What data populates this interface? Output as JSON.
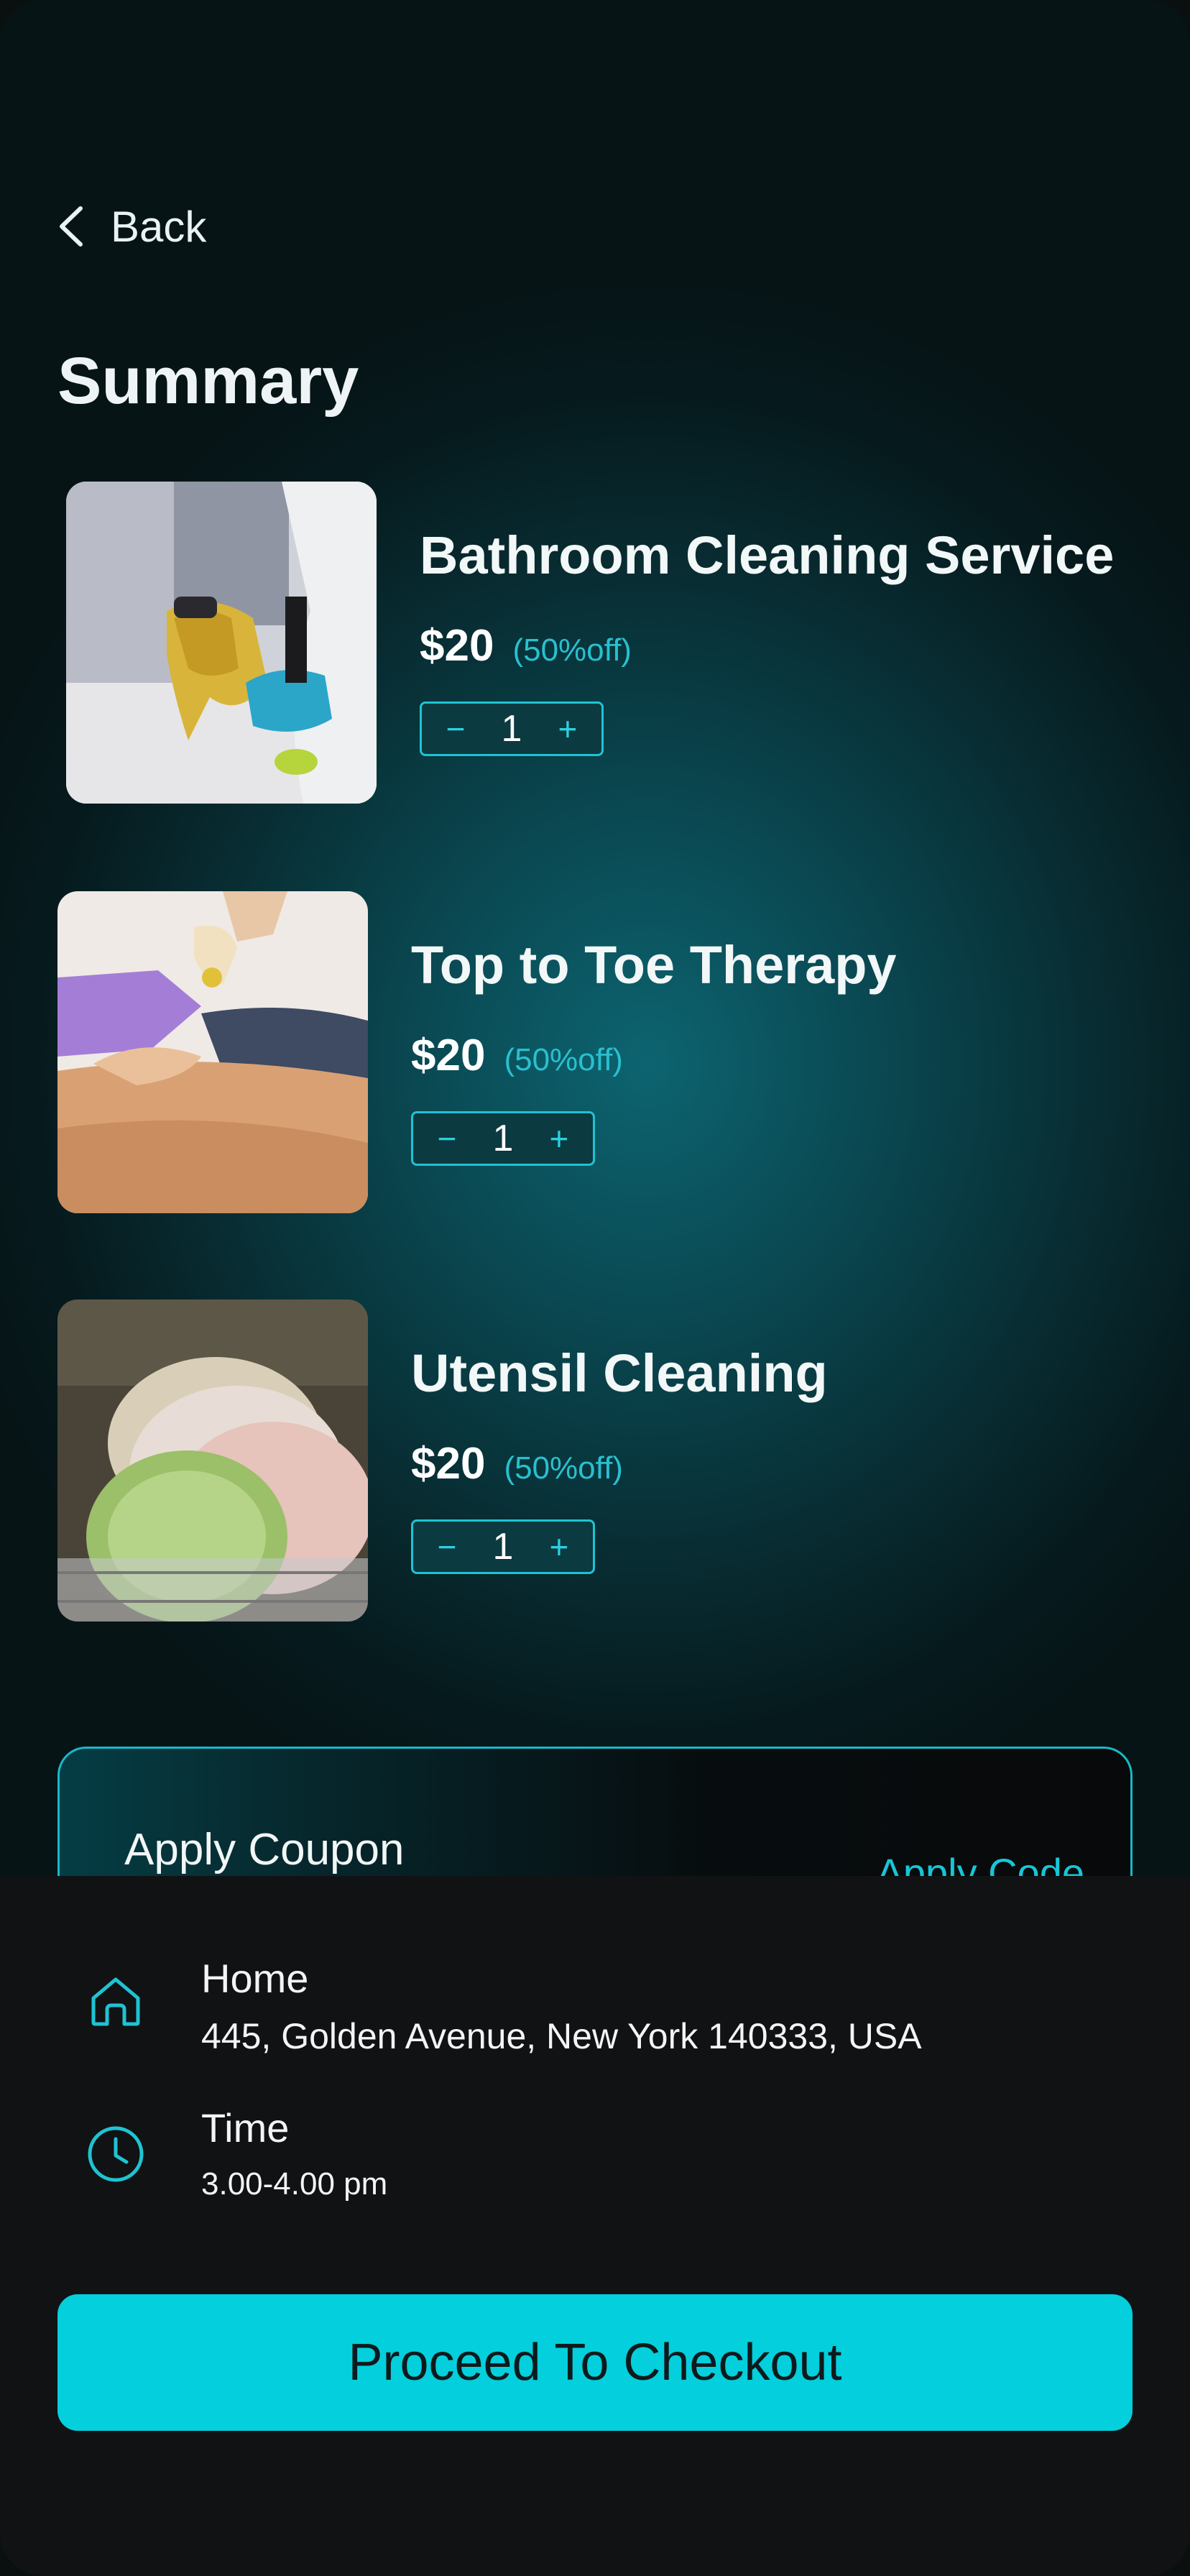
{
  "nav": {
    "back_label": "Back"
  },
  "page": {
    "title": "Summary"
  },
  "items": [
    {
      "name": "Bathroom Cleaning Service",
      "price": "$20",
      "discount": "(50%off)",
      "quantity": "1",
      "decrement": "−",
      "increment": "+"
    },
    {
      "name": "Top to Toe Therapy",
      "price": "$20",
      "discount": "(50%off)",
      "quantity": "1",
      "decrement": "−",
      "increment": "+"
    },
    {
      "name": "Utensil Cleaning",
      "price": "$20",
      "discount": "(50%off)",
      "quantity": "1",
      "decrement": "−",
      "increment": "+"
    }
  ],
  "coupon": {
    "label": "Apply Coupon",
    "action": "Apply Code"
  },
  "address": {
    "icon": "home-icon",
    "title": "Home",
    "value": "445, Golden Avenue, New York 140333, USA"
  },
  "time": {
    "icon": "clock-icon",
    "title": "Time",
    "value": "3.00-4.00 pm"
  },
  "checkout": {
    "label": "Proceed To Checkout"
  },
  "colors": {
    "accent": "#04cfdc",
    "discount": "#29c0cf",
    "panel": "#101213",
    "background": "#082f35"
  }
}
